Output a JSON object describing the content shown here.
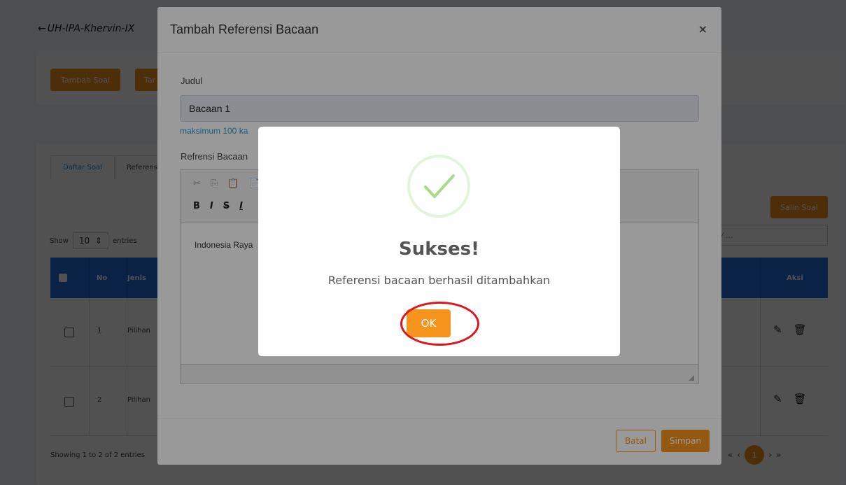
{
  "background": {
    "back_link": "UH-IPA-Khervin-IX",
    "buttons": {
      "add_question": "Tambah Soal",
      "add_other": "Tar",
      "copy_questions": "Salin Soal"
    },
    "tabs": [
      "Daftar Soal",
      "Referens"
    ],
    "show_label": "Show",
    "show_value": "10",
    "entries_label": "entries",
    "search_placeholder": "l/ ...",
    "table": {
      "headers": {
        "no": "No",
        "type": "Jenis",
        "action": "Aksi"
      },
      "rows": [
        {
          "no": "1",
          "type": "Pilihan"
        },
        {
          "no": "2",
          "type": "Pilihan"
        }
      ]
    },
    "footer_info": "Showing 1 to 2 of 2 entries",
    "pagination": {
      "first": "«",
      "prev": "‹",
      "current": "1",
      "next": "›",
      "last": "»"
    }
  },
  "modal": {
    "title": "Tambah Referensi Bacaan",
    "close_label": "×",
    "judul_label": "Judul",
    "judul_value": "Bacaan 1",
    "hint": "maksimum 100 ka",
    "refrensi_label": "Refrensi Bacaan",
    "editor_content": "Indonesia Raya",
    "cancel_label": "Batal",
    "save_label": "Simpan"
  },
  "alert": {
    "title": "Sukses!",
    "message": "Referensi bacaan berhasil ditambahkan",
    "ok_label": "OK",
    "icon": "success-check-icon",
    "highlight_color": "#e2141b"
  },
  "colors": {
    "accent": "#f7941d",
    "table_header": "#1e6fd9",
    "hint": "#2a9bd5"
  }
}
